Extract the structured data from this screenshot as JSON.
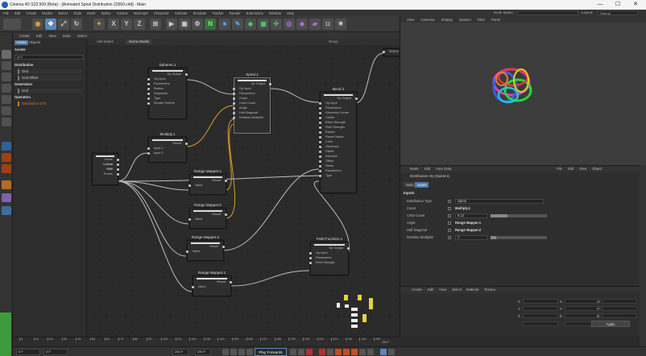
{
  "window": {
    "title": "Cinema 4D S22.909 (Beta) - [Animated Spiral Distribution 22660.c4d] - Main",
    "minimize": "—",
    "maximize": "☐",
    "close": "✕"
  },
  "menubar": {
    "items": [
      "File",
      "Edit",
      "Create",
      "Modes",
      "Select",
      "Tools",
      "Mesh",
      "Spline",
      "Volume",
      "MoGraph",
      "Character",
      "Animate",
      "Simulate",
      "Tracker",
      "Render",
      "Extensions",
      "Window",
      "Help"
    ],
    "node_space_label": "Node Space:",
    "layout_label": "Layout:",
    "layout_value": "Startup"
  },
  "toolbar": {
    "x_label": "X",
    "y_label": "Y",
    "z_label": "Z",
    "n_label": "N"
  },
  "node_editor": {
    "menu": [
      "Create",
      "Edit",
      "View",
      "Node",
      "Select"
    ],
    "tabs": [
      "Add Nodes",
      "Scene Nodes"
    ],
    "right_tab": "Group",
    "nodes": {
      "spheres": {
        "title": "Spheres.1",
        "out": "Op Output",
        "ports": [
          "Op Input",
          "Parameters",
          "Radius",
          "Segments",
          "Type",
          "Render Perfect"
        ]
      },
      "spiral": {
        "title": "Spiral.1",
        "out": "Op Output",
        "ports": [
          "Op Input",
          "Parameters",
          "Count",
          "Color Count",
          "Angle",
          "Half Diagonal",
          "Rotation Multiplier"
        ]
      },
      "bend": {
        "title": "Bend.2",
        "out": "Op Output",
        "ports": [
          "Op Input",
          "Parameters",
          "Geometry Center",
          "Center",
          "Effect Strength",
          "Field Strength",
          "Radius",
          "Parent Matrix",
          "Color",
          "Geometry",
          "Falloff",
          "Direction",
          "Offset",
          "Fields",
          "Parameters",
          "Type"
        ]
      },
      "multiply": {
        "title": "Multiply.1",
        "out": "Result",
        "ports": [
          "Input 1",
          "Input 2"
        ]
      },
      "time": {
        "title": "",
        "ports": [
          "Scene Time",
          "System Time",
          "FPS",
          "Frame"
        ]
      },
      "rm1": {
        "title": "Range Mapper.1",
        "out": "Result",
        "ports": [
          "Value"
        ]
      },
      "rm2": {
        "title": "Range Mapper.2",
        "out": "Result",
        "ports": [
          "Value"
        ]
      },
      "rm3": {
        "title": "Range Mapper.3",
        "out": "Result",
        "ports": [
          "Value"
        ]
      },
      "rm4": {
        "title": "Range Mapper.4",
        "out": "Result",
        "ports": [
          "Value"
        ]
      },
      "field": {
        "title": "Field Function.1",
        "out": "Op Output",
        "ports": [
          "Op Input",
          "Parameters",
          "Field Strength"
        ]
      },
      "scene_out": {
        "title": "Scene"
      }
    }
  },
  "asset_panel": {
    "tabs": [
      "Assets",
      "Objects"
    ],
    "section": "Assets",
    "search": "grid",
    "items": [
      {
        "label": "Distribution",
        "type": "cat"
      },
      {
        "label": "Grid",
        "type": "sub"
      },
      {
        "label": "Grid Offset",
        "type": "sub"
      },
      {
        "label": "Generation",
        "type": "cat"
      },
      {
        "label": "Grid",
        "type": "sub"
      },
      {
        "label": "Operators",
        "type": "cat"
      },
      {
        "label": "Distribution Grid",
        "type": "orange"
      }
    ]
  },
  "viewport": {
    "menu": [
      "View",
      "Cameras",
      "Display",
      "Options",
      "Filter",
      "Panel"
    ]
  },
  "attributes": {
    "menu": [
      "Mode",
      "Edit",
      "User Data"
    ],
    "menu_right": [
      "File",
      "Edit",
      "View",
      "Object"
    ],
    "title": "Distribution Op (Spiral.1)",
    "tabs": [
      "Basic",
      "Inputs"
    ],
    "section": "Inputs",
    "rows": [
      {
        "label": "Distribution Type",
        "value": "Spiral",
        "kind": "dropdown"
      },
      {
        "label": "Count",
        "value": "Multiply.1",
        "kind": "link"
      },
      {
        "label": "Color Count",
        "value": "5.12",
        "kind": "slider",
        "fill": 0.3
      },
      {
        "label": "Angle",
        "value": "Range Mapper.1",
        "kind": "link"
      },
      {
        "label": "Half Diagonal",
        "value": "Range Mapper.2",
        "kind": "link"
      },
      {
        "label": "Rotation Multiplier",
        "value": "1",
        "kind": "slider",
        "fill": 0.1
      }
    ]
  },
  "coordinates": {
    "menu": [
      "Create",
      "Edit",
      "View",
      "Select",
      "Material",
      "Texture"
    ],
    "labels": [
      "X",
      "Y",
      "Z"
    ],
    "labels_right": [
      "H",
      "P",
      "B"
    ],
    "apply": "Apply"
  },
  "timeline": {
    "ticks": [
      "0",
      "10",
      "20",
      "30",
      "40",
      "50",
      "60",
      "70",
      "80",
      "90",
      "100",
      "110",
      "120",
      "130",
      "140",
      "150",
      "160",
      "170",
      "180",
      "190",
      "200",
      "210",
      "220",
      "230",
      "240",
      "250"
    ],
    "end_label": "250 F",
    "current": "0 F",
    "start": "0 F",
    "end": "250 F",
    "end2": "250 F",
    "play_button": "Play Forwards"
  },
  "colors": {
    "accent": "#5d86b7",
    "orange_wire": "#d99a2e",
    "gray_wire": "#bdbdbd",
    "green": "#3d9a3d"
  }
}
